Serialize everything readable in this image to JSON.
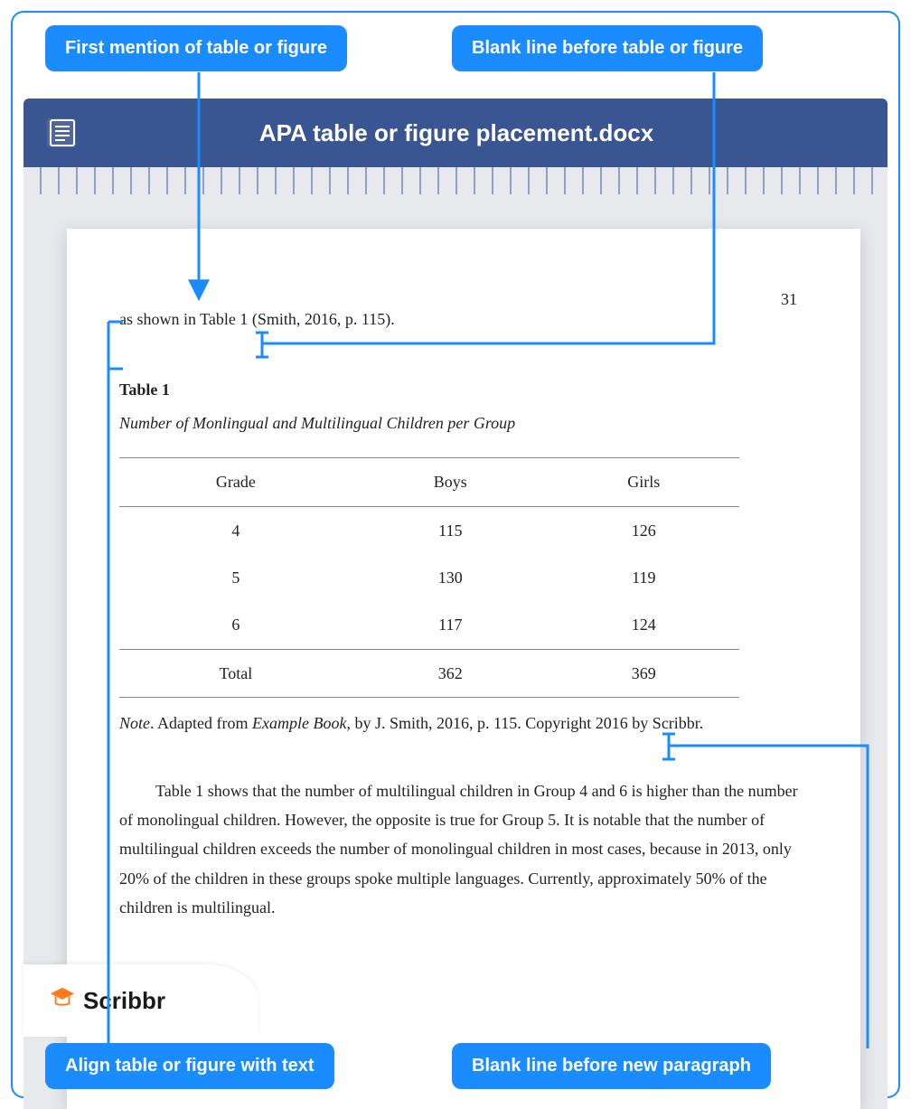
{
  "callouts": {
    "top_left": "First mention of table or figure",
    "top_right": "Blank line before table or figure",
    "bottom_left": "Align table or figure with text",
    "bottom_right": "Blank line before new paragraph"
  },
  "wordbar": {
    "title": "APA table or figure placement.docx"
  },
  "page": {
    "number": "31",
    "line1": "as shown in Table 1 (Smith, 2016, p. 115).",
    "table_label": "Table 1",
    "table_caption": "Number of Monlingual and Multilingual Children per Group",
    "headers": [
      "Grade",
      "Boys",
      "Girls"
    ],
    "rows": [
      [
        "4",
        "115",
        "126"
      ],
      [
        "5",
        "130",
        "119"
      ],
      [
        "6",
        "117",
        "124"
      ]
    ],
    "total_row": [
      "Total",
      "362",
      "369"
    ],
    "note_word": "Note",
    "note_pre": ". Adapted from ",
    "note_book": "Example Book",
    "note_rest": ", by J. Smith, 2016, p. 115. Copyright 2016 by Scribbr.",
    "paragraph": "Table 1 shows that the number of multilingual children in Group 4 and 6 is higher than the number of monolingual children. However, the opposite is true for Group 5. It is notable that the number of multilingual children exceeds the number of monolingual children in most cases, because in 2013, only 20% of the children in these groups spoke multiple languages. Currently, approximately 50% of the children is multilingual."
  },
  "brand": {
    "name": "Scribbr"
  },
  "chart_data": {
    "type": "table",
    "title": "Number of Monlingual and Multilingual Children per Group",
    "columns": [
      "Grade",
      "Boys",
      "Girls"
    ],
    "rows": [
      {
        "Grade": "4",
        "Boys": 115,
        "Girls": 126
      },
      {
        "Grade": "5",
        "Boys": 130,
        "Girls": 119
      },
      {
        "Grade": "6",
        "Boys": 117,
        "Girls": 124
      },
      {
        "Grade": "Total",
        "Boys": 362,
        "Girls": 369
      }
    ]
  }
}
